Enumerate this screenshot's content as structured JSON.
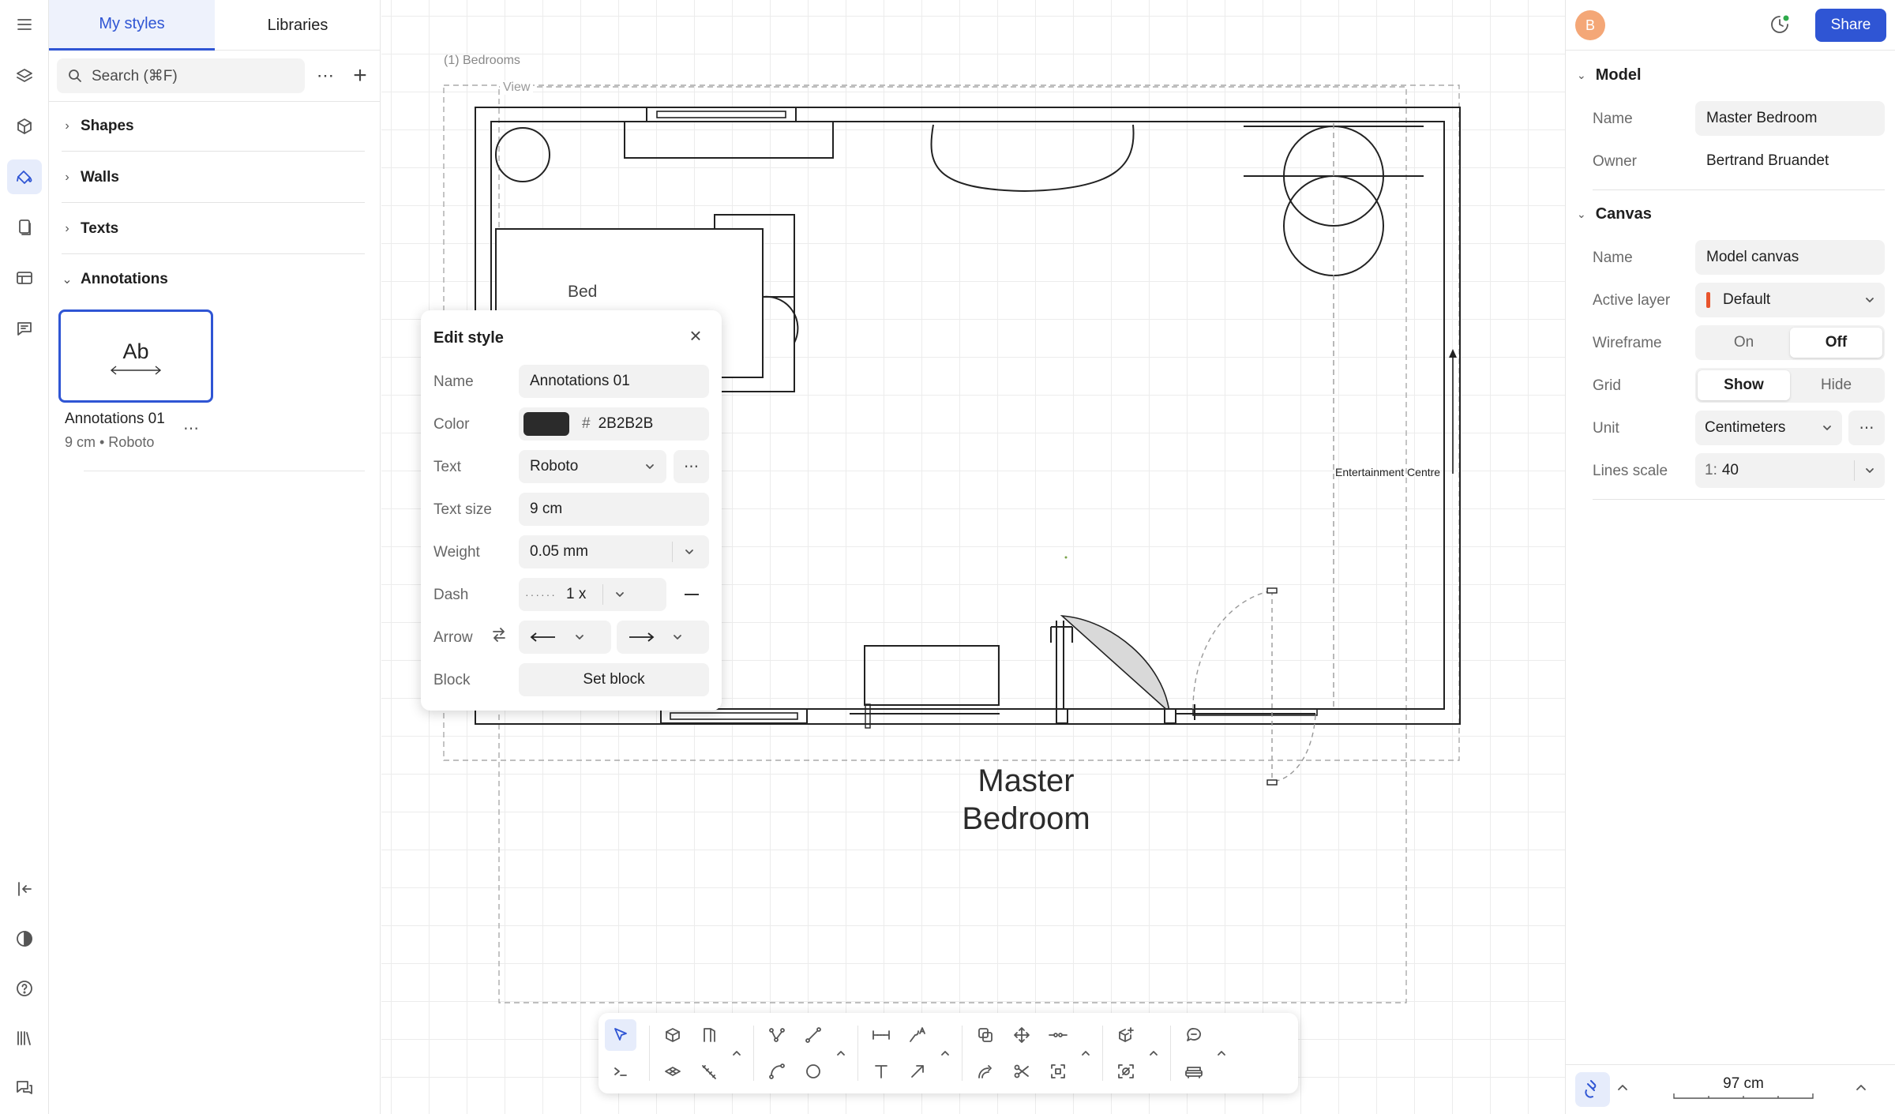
{
  "rail": {
    "top_icons": [
      "menu-icon",
      "layers-icon",
      "cube-icon",
      "paint-icon",
      "pages-icon",
      "table-icon",
      "comments-icon"
    ],
    "bottom_icons": [
      "collapse-icon",
      "contrast-icon",
      "help-icon",
      "library-icon",
      "feedback-icon"
    ]
  },
  "styles_panel": {
    "tabs": [
      "My styles",
      "Libraries"
    ],
    "active_tab": "My styles",
    "search_placeholder": "Search (⌘F)",
    "sections": [
      "Shapes",
      "Walls",
      "Texts",
      "Annotations"
    ],
    "style_item": {
      "preview": "Ab",
      "name": "Annotations 01",
      "meta": "9 cm • Roboto"
    }
  },
  "canvas": {
    "group_label": "(1) Bedrooms",
    "view_label": "View",
    "bed_label": "Bed",
    "side_label": "Entertainment Centre",
    "room_name_line1": "Master",
    "room_name_line2": "Bedroom"
  },
  "edit_style": {
    "title": "Edit style",
    "name_label": "Name",
    "name_value": "Annotations 01",
    "color_label": "Color",
    "color_hash": "#",
    "color_value": "2B2B2B",
    "text_label": "Text",
    "text_value": "Roboto",
    "size_label": "Text size",
    "size_value": "9 cm",
    "weight_label": "Weight",
    "weight_value": "0.05 mm",
    "dash_label": "Dash",
    "dash_value": "1 x",
    "arrow_label": "Arrow",
    "block_label": "Block",
    "block_button": "Set block"
  },
  "topbar": {
    "avatar": "B",
    "share": "Share"
  },
  "properties": {
    "model_title": "Model",
    "model_name_label": "Name",
    "model_name": "Master Bedroom",
    "owner_label": "Owner",
    "owner": "Bertrand Bruandet",
    "canvas_title": "Canvas",
    "canvas_name_label": "Name",
    "canvas_name": "Model canvas",
    "active_layer_label": "Active layer",
    "active_layer": "Default",
    "layer_color": "#e8542c",
    "wireframe_label": "Wireframe",
    "wireframe_options": [
      "On",
      "Off"
    ],
    "wireframe_selected": "Off",
    "grid_label": "Grid",
    "grid_options": [
      "Show",
      "Hide"
    ],
    "grid_selected": "Show",
    "unit_label": "Unit",
    "unit": "Centimeters",
    "lines_scale_label": "Lines scale",
    "lines_scale_prefix": "1:",
    "lines_scale": "40"
  },
  "status": {
    "scale_value": "97 cm"
  },
  "colors": {
    "accent": "#2f55d4",
    "style_color": "#2B2B2B"
  }
}
